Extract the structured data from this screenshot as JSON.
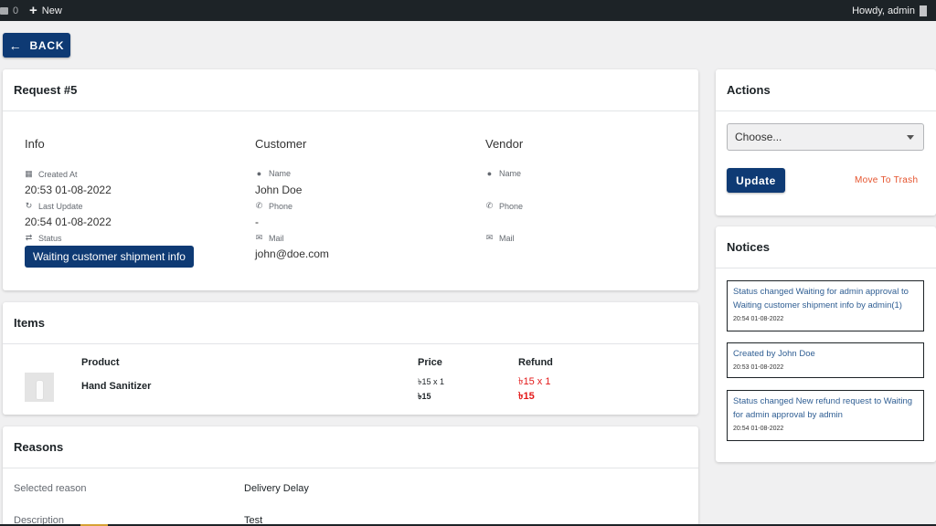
{
  "adminbar": {
    "comments_count": "0",
    "new_label": "New",
    "howdy": "Howdy, admin"
  },
  "back_button": {
    "label": "BACK"
  },
  "request": {
    "title": "Request #5",
    "info": {
      "heading": "Info",
      "created_label": "Created At",
      "created_value": "20:53 01-08-2022",
      "updated_label": "Last Update",
      "updated_value": "20:54 01-08-2022",
      "status_label": "Status",
      "status_value": "Waiting customer shipment info"
    },
    "customer": {
      "heading": "Customer",
      "name_label": "Name",
      "name_value": "John Doe",
      "phone_label": "Phone",
      "phone_value": "-",
      "mail_label": "Mail",
      "mail_value": "john@doe.com"
    },
    "vendor": {
      "heading": "Vendor",
      "name_label": "Name",
      "phone_label": "Phone",
      "mail_label": "Mail"
    }
  },
  "items": {
    "title": "Items",
    "headers": {
      "product": "Product",
      "price": "Price",
      "refund": "Refund"
    },
    "rows": [
      {
        "product": "Hand Sanitizer",
        "price_line": "৳15 x 1",
        "price_total": "৳15",
        "refund_line": "৳15 x 1",
        "refund_total": "৳15"
      }
    ]
  },
  "reasons": {
    "title": "Reasons",
    "selected_label": "Selected reason",
    "selected_value": "Delivery Delay",
    "description_label": "Description",
    "description_value": "Test"
  },
  "actions": {
    "title": "Actions",
    "select_value": "Choose...",
    "update_label": "Update",
    "trash_label": "Move To Trash"
  },
  "notices": {
    "title": "Notices",
    "items": [
      {
        "text": "Status changed Waiting for admin approval to Waiting customer shipment info by admin(1)",
        "time": "20:54 01-08-2022"
      },
      {
        "text": "Created by John Doe",
        "time": "20:53 01-08-2022"
      },
      {
        "text": "Status changed New refund request to Waiting for admin approval by admin",
        "time": "20:54 01-08-2022"
      }
    ]
  },
  "colors": {
    "primary": "#0e3a74",
    "danger": "#e31818",
    "trash": "#e5532d",
    "adminbar": "#1d2327",
    "background": "#f0f0f1"
  }
}
